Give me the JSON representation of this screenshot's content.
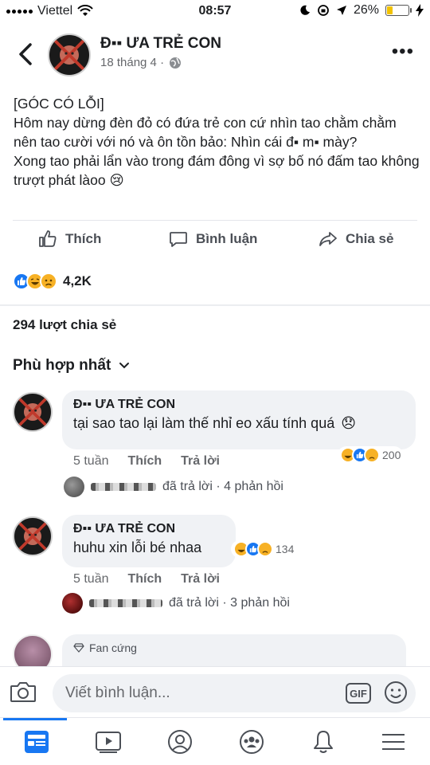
{
  "status_bar": {
    "carrier": "Viettel",
    "time": "08:57",
    "battery": "26%",
    "battery_level": 0.26
  },
  "header": {
    "page_name": "Đ▪▪ ƯA TRẺ CON",
    "post_date": "18 tháng 4 ·"
  },
  "post": {
    "lines": [
      "[GÓC CÓ LỖI]",
      "Hôm nay dừng đèn đỏ có đứa trẻ con cứ nhìn tao chằm chằm nên tao cười với nó và ôn tồn bảo: Nhìn cái đ▪ m▪ mày?",
      "Xong tao phải lẩn vào trong đám đông vì sợ bố nó đấm tao không trượt phát làoo 😢"
    ]
  },
  "actions": {
    "like": "Thích",
    "comment": "Bình luận",
    "share": "Chia sẻ"
  },
  "reactions": {
    "count": "4,2K",
    "types": [
      "like-icon",
      "haha-icon",
      "sad-icon"
    ]
  },
  "shares": "294 lượt chia sẻ",
  "sort_label": "Phù hợp nhất",
  "comments": [
    {
      "author": "Đ▪▪ ƯA TRẺ CON",
      "text": "tại sao tao lại làm thế nhỉ eo xấu tính quá",
      "emoji": "😞",
      "time": "5 tuần",
      "like": "Thích",
      "reply": "Trả lời",
      "reaction_count": "200",
      "replies_text": "đã trả lời · 4 phản hồi"
    },
    {
      "author": "Đ▪▪ ƯA TRẺ CON",
      "text": "huhu xin lỗi bé nhaa",
      "time": "5 tuần",
      "like": "Thích",
      "reply": "Trả lời",
      "reaction_count": "134",
      "replies_text": "đã trả lời · 3 phản hồi"
    },
    {
      "badge": "Fan cứng"
    }
  ],
  "composer": {
    "placeholder": "Viết bình luận...",
    "gif": "GIF"
  },
  "colors": {
    "facebook_blue": "#1877f2",
    "haha_yellow": "#f7b125",
    "text_secondary": "#65676b"
  }
}
